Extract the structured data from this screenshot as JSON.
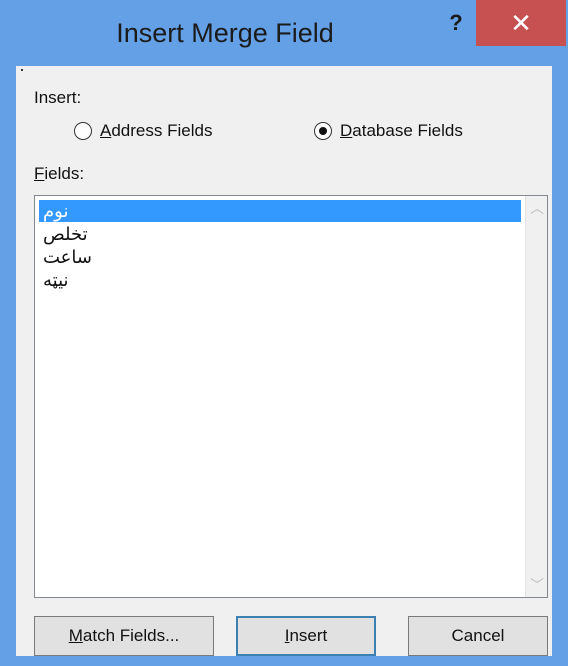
{
  "dialog": {
    "title": "Insert Merge Field",
    "help": "?",
    "close": "✕"
  },
  "insert": {
    "label": "Insert:",
    "options": [
      {
        "prefix": "",
        "accel": "A",
        "rest": "ddress Fields",
        "checked": false
      },
      {
        "prefix": "",
        "accel": "D",
        "rest": "atabase Fields",
        "checked": true
      }
    ]
  },
  "fields": {
    "label_accel": "F",
    "label_rest": "ields:",
    "items": [
      {
        "text": "نوم",
        "selected": true
      },
      {
        "text": "تخلص",
        "selected": false
      },
      {
        "text": "ساعت",
        "selected": false
      },
      {
        "text": "نیټه",
        "selected": false
      }
    ],
    "scroll_up": "︿",
    "scroll_down": "﹀"
  },
  "buttons": {
    "match_accel": "M",
    "match_rest": "atch Fields...",
    "insert_accel": "I",
    "insert_rest": "nsert",
    "cancel": "Cancel"
  }
}
